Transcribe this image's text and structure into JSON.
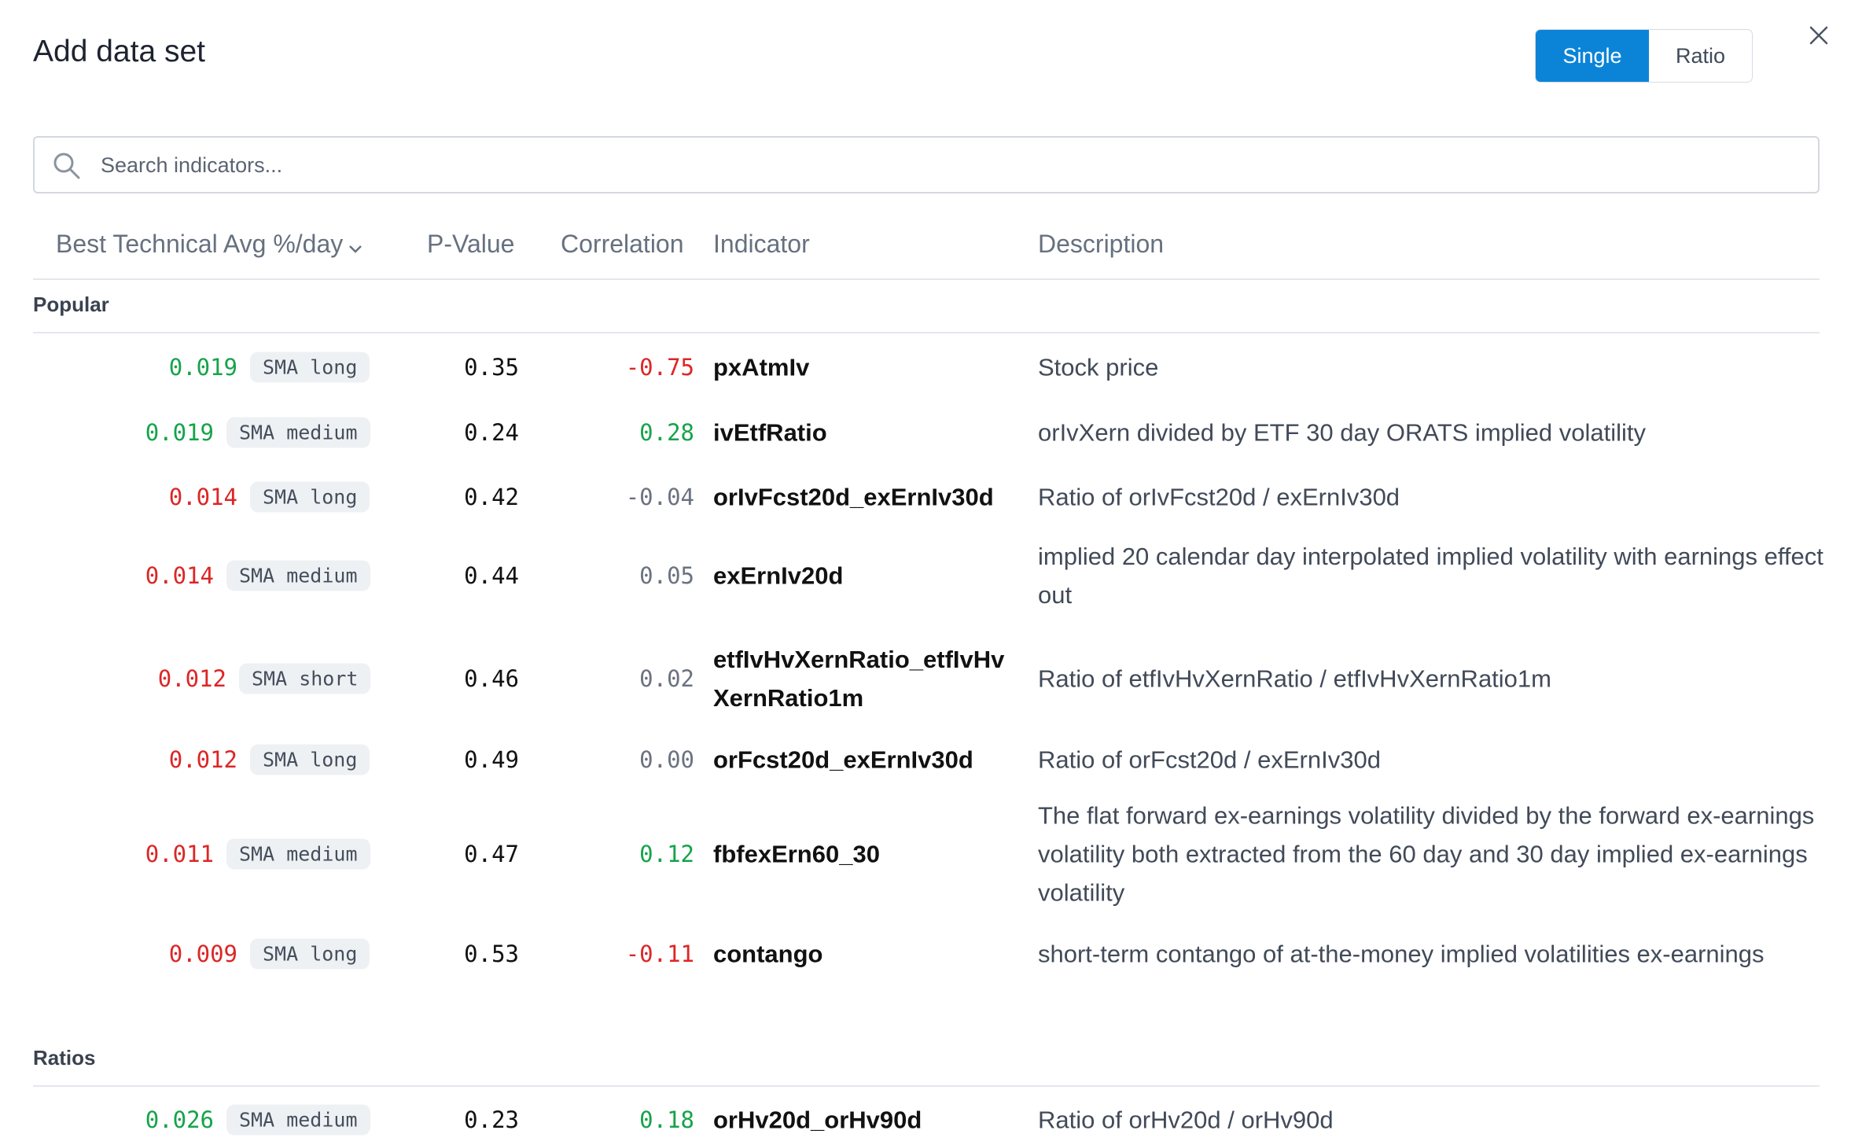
{
  "modal": {
    "title": "Add data set"
  },
  "toggle": {
    "single_label": "Single",
    "ratio_label": "Ratio",
    "selected": "Single"
  },
  "search": {
    "placeholder": "Search indicators..."
  },
  "columns": {
    "avg": "Best Technical Avg %/day",
    "pvalue": "P-Value",
    "correlation": "Correlation",
    "indicator": "Indicator",
    "description": "Description"
  },
  "colors": {
    "accent": "#0b84d8",
    "positive": "#16a34a",
    "negative": "#dc2626",
    "neutral": "#6b7280"
  },
  "groups": [
    {
      "label": "Popular",
      "rows": [
        {
          "avg": "0.019",
          "avg_tone": "green",
          "tech": "SMA long",
          "pvalue": "0.35",
          "corr": "-0.75",
          "corr_tone": "red",
          "indicator": "pxAtmIv",
          "description": "Stock price"
        },
        {
          "avg": "0.019",
          "avg_tone": "green",
          "tech": "SMA medium",
          "pvalue": "0.24",
          "corr": "0.28",
          "corr_tone": "green",
          "indicator": "ivEtfRatio",
          "description": "orIvXern divided by ETF 30 day ORATS implied volatility"
        },
        {
          "avg": "0.014",
          "avg_tone": "red",
          "tech": "SMA long",
          "pvalue": "0.42",
          "corr": "-0.04",
          "corr_tone": "grey",
          "indicator": "orIvFcst20d_exErnIv30d",
          "description": "Ratio of orIvFcst20d / exErnIv30d"
        },
        {
          "avg": "0.014",
          "avg_tone": "red",
          "tech": "SMA medium",
          "pvalue": "0.44",
          "corr": "0.05",
          "corr_tone": "grey",
          "indicator": "exErnIv20d",
          "description": "implied 20 calendar day interpolated implied volatility with earnings effect out"
        },
        {
          "avg": "0.012",
          "avg_tone": "red",
          "tech": "SMA short",
          "pvalue": "0.46",
          "corr": "0.02",
          "corr_tone": "grey",
          "indicator": "etfIvHvXernRatio_etfIvHvXernRatio1m",
          "description": "Ratio of etfIvHvXernRatio / etfIvHvXernRatio1m"
        },
        {
          "avg": "0.012",
          "avg_tone": "red",
          "tech": "SMA long",
          "pvalue": "0.49",
          "corr": "0.00",
          "corr_tone": "grey",
          "indicator": "orFcst20d_exErnIv30d",
          "description": "Ratio of orFcst20d / exErnIv30d"
        },
        {
          "avg": "0.011",
          "avg_tone": "red",
          "tech": "SMA medium",
          "pvalue": "0.47",
          "corr": "0.12",
          "corr_tone": "green",
          "indicator": "fbfexErn60_30",
          "description": "The flat forward ex-earnings volatility divided by the forward ex-earnings volatility both extracted from the 60 day and 30 day implied ex-earnings volatility"
        },
        {
          "avg": "0.009",
          "avg_tone": "red",
          "tech": "SMA long",
          "pvalue": "0.53",
          "corr": "-0.11",
          "corr_tone": "red",
          "indicator": "contango",
          "description": "short-term contango of at-the-money implied volatilities ex-earnings"
        }
      ]
    },
    {
      "label": "Ratios",
      "rows": [
        {
          "avg": "0.026",
          "avg_tone": "green",
          "tech": "SMA medium",
          "pvalue": "0.23",
          "corr": "0.18",
          "corr_tone": "green",
          "indicator": "orHv20d_orHv90d",
          "description": "Ratio of orHv20d / orHv90d"
        }
      ]
    }
  ]
}
